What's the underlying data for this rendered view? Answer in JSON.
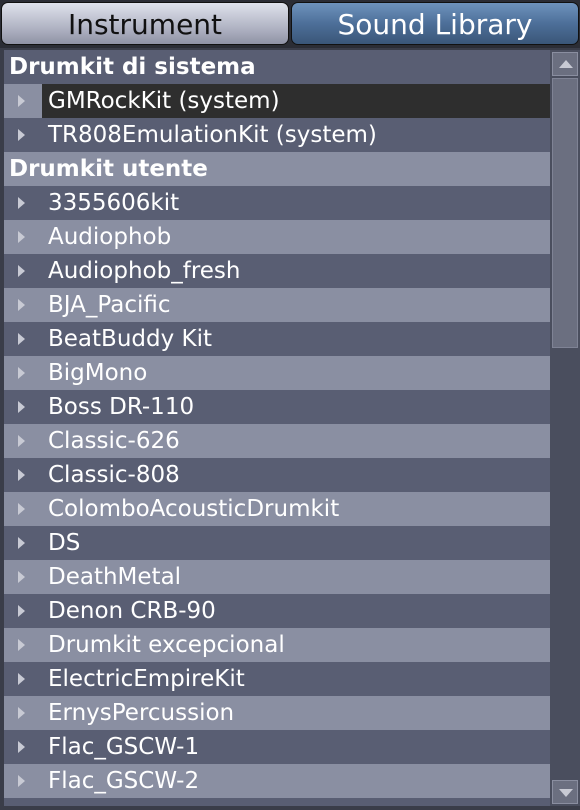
{
  "tabs": {
    "instrument": "Instrument",
    "sound_library": "Sound Library",
    "active": "Sound Library"
  },
  "sections": [
    {
      "title": "Drumkit di sistema",
      "items": [
        "GMRockKit (system)",
        "TR808EmulationKit (system)"
      ],
      "selected": "GMRockKit (system)"
    },
    {
      "title": "Drumkit utente",
      "items": [
        "3355606kit",
        "Audiophob",
        "Audiophob_fresh",
        "BJA_Pacific",
        "BeatBuddy Kit",
        "BigMono",
        "Boss DR-110",
        "Classic-626",
        "Classic-808",
        "ColomboAcousticDrumkit",
        "DS",
        "DeathMetal",
        "Denon CRB-90",
        "Drumkit excepcional",
        "ElectricEmpireKit",
        "ErnysPercussion",
        "Flac_GSCW-1",
        "Flac_GSCW-2"
      ]
    }
  ],
  "scrollbar": {
    "position": 0
  }
}
